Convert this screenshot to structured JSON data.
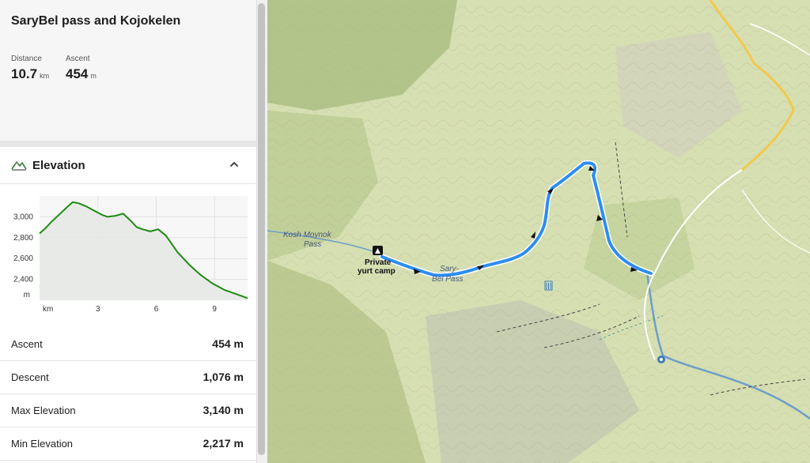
{
  "route": {
    "title": "SaryBel pass and Kojokelen",
    "distance": {
      "label": "Distance",
      "value": "10.7",
      "unit": "km"
    },
    "ascent": {
      "label": "Ascent",
      "value": "454",
      "unit": "m"
    }
  },
  "elevation": {
    "title": "Elevation",
    "icons": {
      "section": "mountain-chart-icon",
      "toggle": "chevron-up-icon"
    }
  },
  "chart_data": {
    "type": "area",
    "xlabel": "km",
    "ylabel": "m",
    "xlim": [
      0,
      10.7
    ],
    "ylim": [
      2200,
      3200
    ],
    "grid": true,
    "x_ticks": [
      3,
      6,
      9
    ],
    "x_tick_labels": [
      "3",
      "6",
      "9"
    ],
    "y_ticks": [
      2400,
      2600,
      2800,
      3000
    ],
    "y_tick_labels": [
      "2,400",
      "2,600",
      "2,800",
      "3,000"
    ],
    "color": "#1f8a12",
    "x": [
      0,
      0.3,
      0.6,
      1.0,
      1.4,
      1.7,
      2.0,
      2.4,
      2.8,
      3.2,
      3.5,
      3.9,
      4.3,
      4.7,
      5.0,
      5.3,
      5.7,
      6.1,
      6.5,
      6.8,
      7.1,
      7.4,
      7.7,
      8.0,
      8.3,
      8.6,
      8.9,
      9.2,
      9.5,
      9.8,
      10.1,
      10.4,
      10.7
    ],
    "y": [
      2840,
      2890,
      2950,
      3020,
      3090,
      3140,
      3130,
      3100,
      3060,
      3020,
      3000,
      3010,
      3030,
      2960,
      2900,
      2880,
      2860,
      2880,
      2820,
      2740,
      2660,
      2600,
      2540,
      2490,
      2440,
      2400,
      2360,
      2330,
      2300,
      2280,
      2260,
      2240,
      2220
    ]
  },
  "stats": [
    {
      "label": "Ascent",
      "value": "454 m"
    },
    {
      "label": "Descent",
      "value": "1,076 m"
    },
    {
      "label": "Max Elevation",
      "value": "3,140 m"
    },
    {
      "label": "Min Elevation",
      "value": "2,217 m"
    }
  ],
  "map": {
    "labels": {
      "kosh_moynok_line1": "Kosh Moynok",
      "kosh_moynok_line2": "Pass",
      "camp_line1": "Private",
      "camp_line2": "yurt camp",
      "sarybel_line1": "Sary-",
      "sarybel_line2": "Bel Pass"
    },
    "colors": {
      "terrain": "#d6dfb2",
      "forest": "#a9bd7f",
      "route": "#2d8df0",
      "road": "#f2c94c",
      "river": "#6d9ec8"
    },
    "icons": [
      "campsite-icon",
      "waterfall-icon",
      "mineral-spring-icon"
    ]
  }
}
